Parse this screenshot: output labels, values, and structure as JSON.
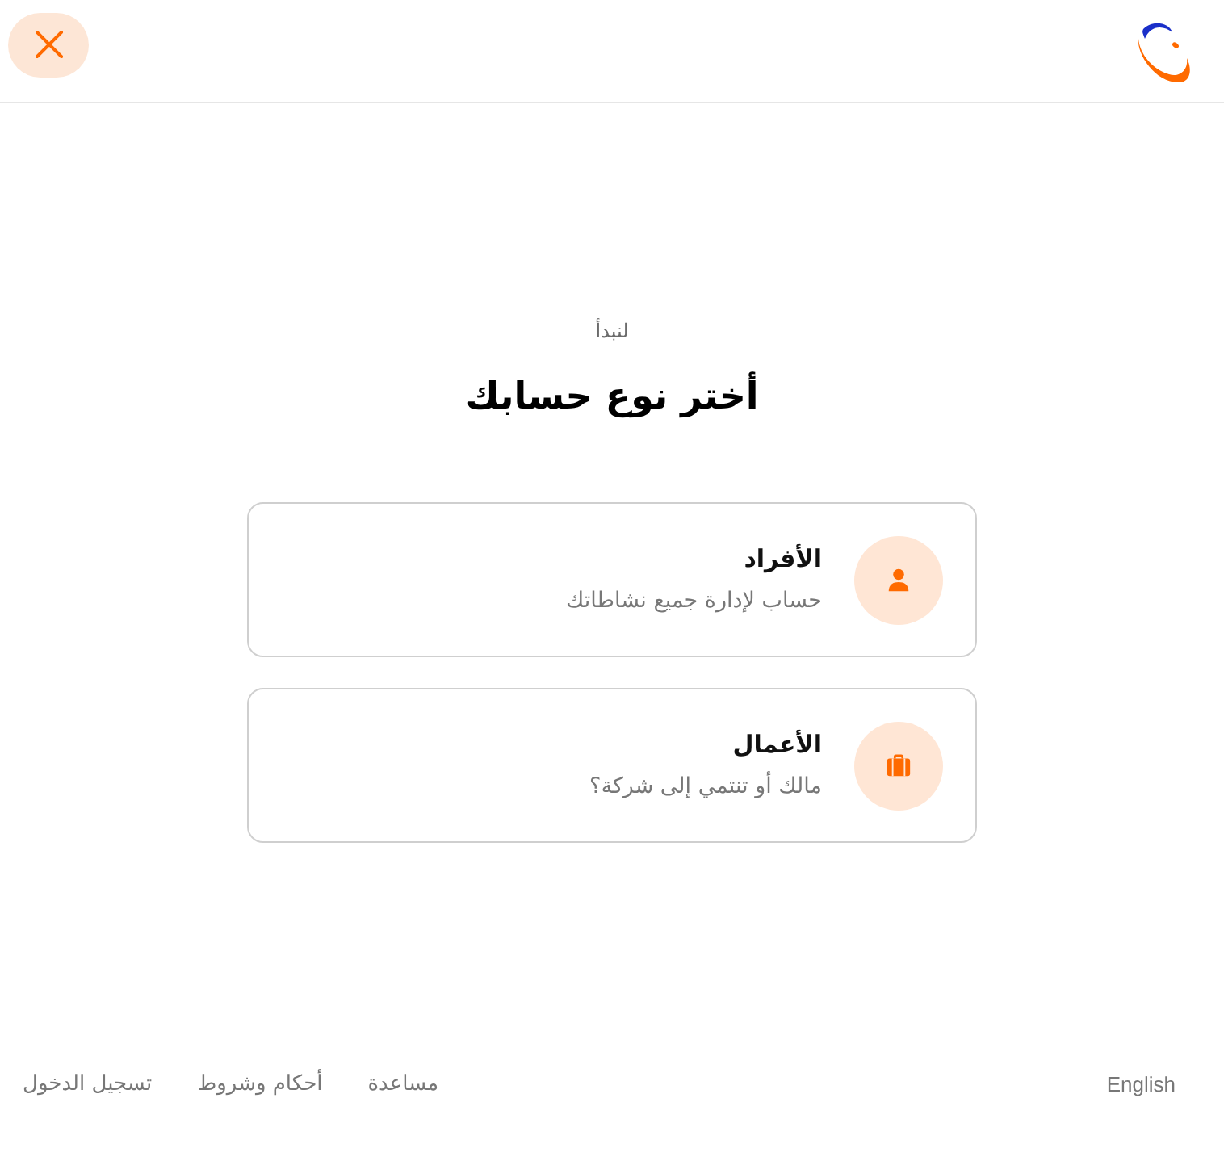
{
  "intro": {
    "eyebrow": "لنبدأ",
    "title": "أختر نوع حسابك"
  },
  "account_types": [
    {
      "kind": "person",
      "title": "الأفراد",
      "description": "حساب لإدارة جميع نشاطاتك"
    },
    {
      "kind": "briefcase",
      "title": "الأعمال",
      "description": "مالك أو تنتمي إلى شركة؟"
    }
  ],
  "footer": {
    "language": "English",
    "links": [
      "مساعدة",
      "أحكام وشروط",
      "تسجيل الدخول"
    ]
  }
}
